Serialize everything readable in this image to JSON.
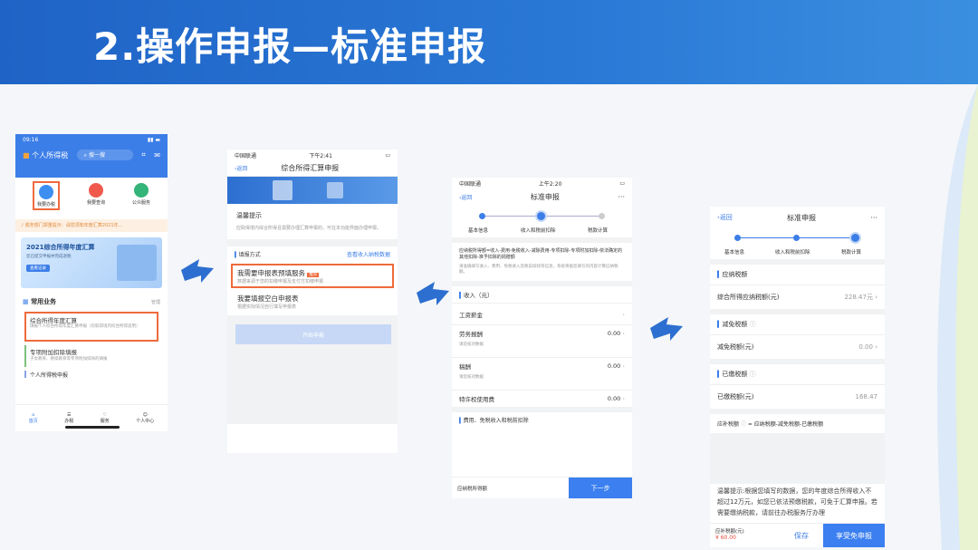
{
  "slide": {
    "title": "2.操作申报—标准申报"
  },
  "p1": {
    "time": "09:16",
    "app_name": "个人所得税",
    "search": "搜一搜",
    "grid": [
      "我要办税",
      "我要查询",
      "公众服务"
    ],
    "notice": "税务部门郑重提示：请您须知年度汇算2021年…",
    "banner_title": "2021综合所得年度汇算",
    "banner_sub": "您已提交申报并完成退税",
    "banner_btn": "查看记录",
    "common_title": "常用业务",
    "manage": "管理",
    "item1_title": "综合所得年度汇算",
    "item1_desc": "填报个人综合所得年度汇算申报（仅取得境内综合所得适用）",
    "item2_title": "专项附加扣除填报",
    "item2_desc": "子女教育、继续教育等专项附加扣除的填报",
    "item3_title": "个人所得税申报",
    "tabs": [
      "首页",
      "办税",
      "服务",
      "个人中心"
    ]
  },
  "p2": {
    "carrier": "中国联通",
    "time": "下午2:41",
    "back": "返回",
    "nav_title": "综合所得汇算申报",
    "tip_title": "温馨提示",
    "tip_text": "应取得境内综合所得且需要办理汇算申报的，可在本功能界面办理申报。",
    "method_label": "填报方式",
    "view_link": "查看收入纳税数据",
    "opt1_title": "我需要申报表预填服务",
    "opt1_badge": "推荐",
    "opt1_desc": "数据来源于您的扣缴申报及支付方扣缴申报",
    "opt2_title": "我要填报空白申报表",
    "opt2_desc": "根据实际情况自行填写申报表",
    "start_btn": "开始申报"
  },
  "p3": {
    "carrier": "中国联通",
    "time": "上午2:20",
    "back": "返回",
    "nav_title": "标准申报",
    "more": "···",
    "steps": [
      "基本信息",
      "收入和税前扣除",
      "税款计算"
    ],
    "formula": "应纳税所得额=收入-费用-免税收入-减除费用-专项扣除-专项附加扣除-依法确定的其他扣除-准予扣除的捐赠额",
    "note": "请准确填写收入、费用、免税收入及税前扣除等信息，系统将据您填写的内容计算应纳税额。",
    "income_hdr": "收入（元）",
    "rows": [
      {
        "label": "工资薪金",
        "value": ""
      },
      {
        "label": "劳务报酬",
        "value": "0.00"
      },
      {
        "label": "稿酬",
        "value": "0.00"
      },
      {
        "label": "特许权使用费",
        "value": "0.00"
      }
    ],
    "row_hint": "请您核对数据",
    "deduct_hdr": "费用、免税收入和税前扣除",
    "bottom_label": "应纳税所得额",
    "next_btn": "下一步"
  },
  "p4": {
    "back": "返回",
    "nav_title": "标准申报",
    "more": "···",
    "steps": [
      "基本信息",
      "收入和税前扣除",
      "税款计算"
    ],
    "s1_title": "应纳税额",
    "s1_label": "综合所得应纳税额(元)",
    "s1_value": "228.47元",
    "s2_title": "减免税额",
    "s2_label": "减免税额(元)",
    "s2_value": "0.00",
    "s3_title": "已缴税额",
    "s3_label": "已缴税额(元)",
    "s3_value": "168.47",
    "formula_label": "应补税额",
    "formula_text": "= 应纳税额-减免税额-已缴税额",
    "tip": "温馨提示:根据您填写的数据，您的年度综合所得收入不超过12万元，如您已依法预缴税款，可免于汇算申报。若需要缴纳税款，请前往办税服务厅办理",
    "bottom_label": "应补税额(元)",
    "bottom_value": "¥ 60.00",
    "save_btn": "保存",
    "submit_btn": "享受免申报"
  }
}
